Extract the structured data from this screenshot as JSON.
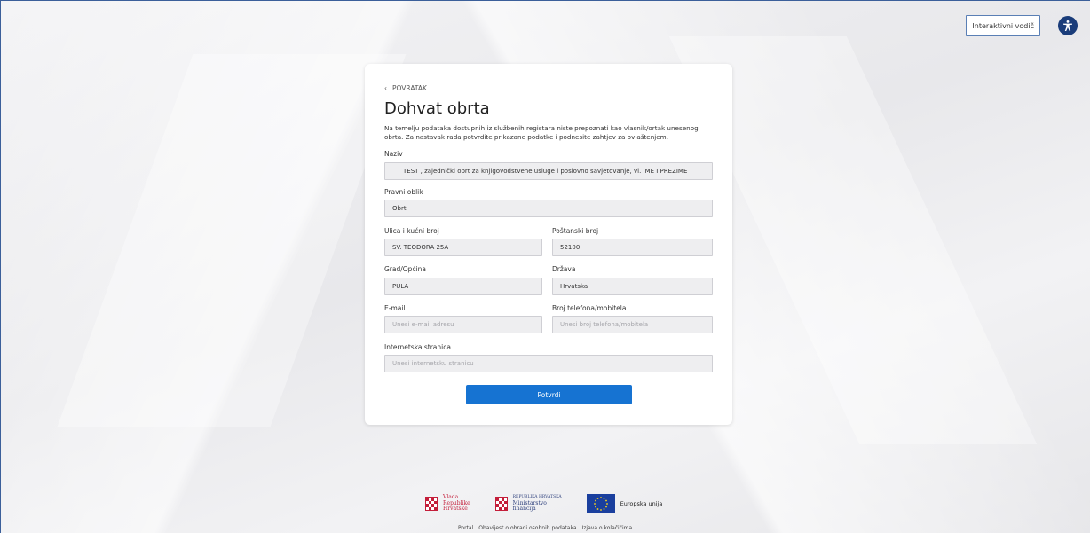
{
  "header": {
    "guide_button": "Interaktivni vodič",
    "accessibility_icon": "accessibility-icon"
  },
  "form": {
    "back_label": "POVRATAK",
    "title": "Dohvat obrta",
    "description": "Na temelju podataka dostupnih iz službenih registara niste prepoznati kao vlasnik/ortak unesenog obrta. Za nastavak rada potvrdite prikazane podatke i podnesite zahtjev za ovlaštenjem.",
    "fields": {
      "naziv": {
        "label": "Naziv",
        "value": "TEST     , zajednički obrt za knjigovodstvene usluge i poslovno savjetovanje, vl.  IME I PREZIME"
      },
      "pravni_oblik": {
        "label": "Pravni oblik",
        "value": "Obrt"
      },
      "ulica": {
        "label": "Ulica i kućni broj",
        "value": "SV. TEODORA  25A"
      },
      "postanski_broj": {
        "label": "Poštanski broj",
        "value": "52100"
      },
      "grad": {
        "label": "Grad/Općina",
        "value": "PULA"
      },
      "drzava": {
        "label": "Država",
        "value": "Hrvatska"
      },
      "email": {
        "label": "E-mail",
        "placeholder": "Unesi e-mail adresu"
      },
      "telefon": {
        "label": "Broj telefona/mobitela",
        "placeholder": "Unesi broj telefona/mobitela"
      },
      "web": {
        "label": "Internetska stranica",
        "placeholder": "Unesi internetsku stranicu"
      }
    },
    "submit_label": "Potvrdi"
  },
  "footer": {
    "logo_vlada": [
      "Vlada",
      "Republike",
      "Hrvatske"
    ],
    "logo_ministarstvo": [
      "REPUBLIKA HRVATSKA",
      "Ministarstvo",
      "financija"
    ],
    "logo_eu": "Europska unija",
    "links": [
      "Portal",
      "Obavijest o obradi osobnih podataka",
      "Izjava o kolačićima"
    ]
  },
  "colors": {
    "accent": "#1673d2",
    "accessibility": "#1a3c7a",
    "crest_red": "#c41e3a",
    "eu_blue": "#1a3f9e"
  }
}
